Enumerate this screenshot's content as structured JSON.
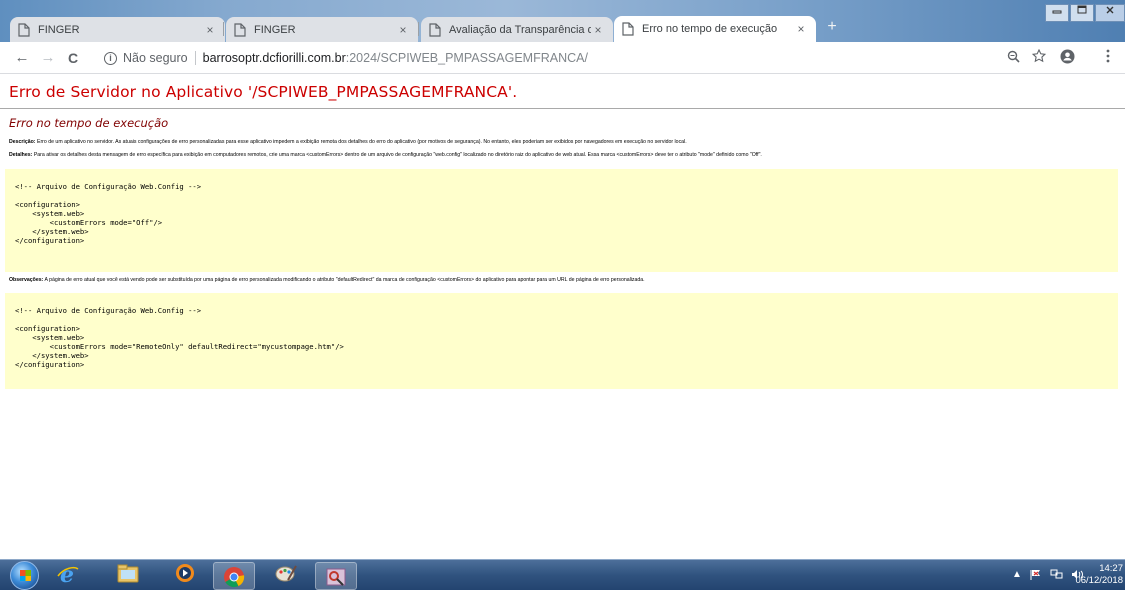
{
  "browser": {
    "tabs": [
      {
        "title": "FINGER",
        "active": false
      },
      {
        "title": "FINGER",
        "active": false
      },
      {
        "title": "Avaliação da Transparência dos",
        "active": false
      },
      {
        "title": "Erro no tempo de execução",
        "active": true
      }
    ],
    "tab_close_glyph": "×",
    "new_tab_glyph": "+",
    "window_controls": [
      "minimize",
      "maximize",
      "close"
    ],
    "back_glyph": "←",
    "forward_glyph": "→",
    "reload_glyph": "C",
    "security_label": "Não seguro",
    "url_host": "barrosoptr.dcfiorilli.com.br",
    "url_rest": ":2024/SCPIWEB_PMPASSAGEMFRANCA/",
    "icons": [
      "info-icon",
      "zoom-icon",
      "star-icon",
      "account-icon",
      "menu-icon"
    ]
  },
  "page": {
    "title": "Erro de Servidor no Aplicativo '/SCPIWEB_PMPASSAGEMFRANCA'.",
    "subtitle": "Erro no tempo de execução",
    "description_label": "Descrição:",
    "description_text": "Erro de um aplicativo no servidor. As atuais configurações de erro personalizadas para esse aplicativo impedem a exibição remota dos detalhes do erro do aplicativo (por motivos de segurança). No entanto, eles poderiam ser exibidos por navegadores em execução no servidor local.",
    "details_label": "Detalhes:",
    "details_text": "Para ativar os detalhes desta mensagem de erro específica para exibição em computadores remotos, crie uma marca <customErrors> dentro de um arquivo de configuração \"web.config\" localizado no diretório raiz do aplicativo de web atual. Essa marca <customErrors> deve ter o atributo \"mode\" definido como \"Off\".",
    "code1": "<!-- Arquivo de Configuração Web.Config -->\n\n<configuration>\n    <system.web>\n        <customErrors mode=\"Off\"/>\n    </system.web>\n</configuration>",
    "notes_label": "Observações:",
    "notes_text": "A página de erro atual que você está vendo pode ser substituída por uma página de erro personalizada modificando o atributo \"defaultRedirect\" da marca de configuração <customErrors> do aplicativo para apontar para um URL de página de erro personalizada.",
    "code2": "<!-- Arquivo de Configuração Web.Config -->\n\n<configuration>\n    <system.web>\n        <customErrors mode=\"RemoteOnly\" defaultRedirect=\"mycustompage.htm\"/>\n    </system.web>\n</configuration>"
  },
  "taskbar": {
    "apps": [
      "internet-explorer",
      "file-explorer",
      "media-player",
      "chrome",
      "paint",
      "snipping-tool"
    ],
    "tray_icons": [
      "show-hidden-icons",
      "action-center-flag",
      "network",
      "volume"
    ],
    "time": "14:27",
    "date": "06/12/2018"
  }
}
